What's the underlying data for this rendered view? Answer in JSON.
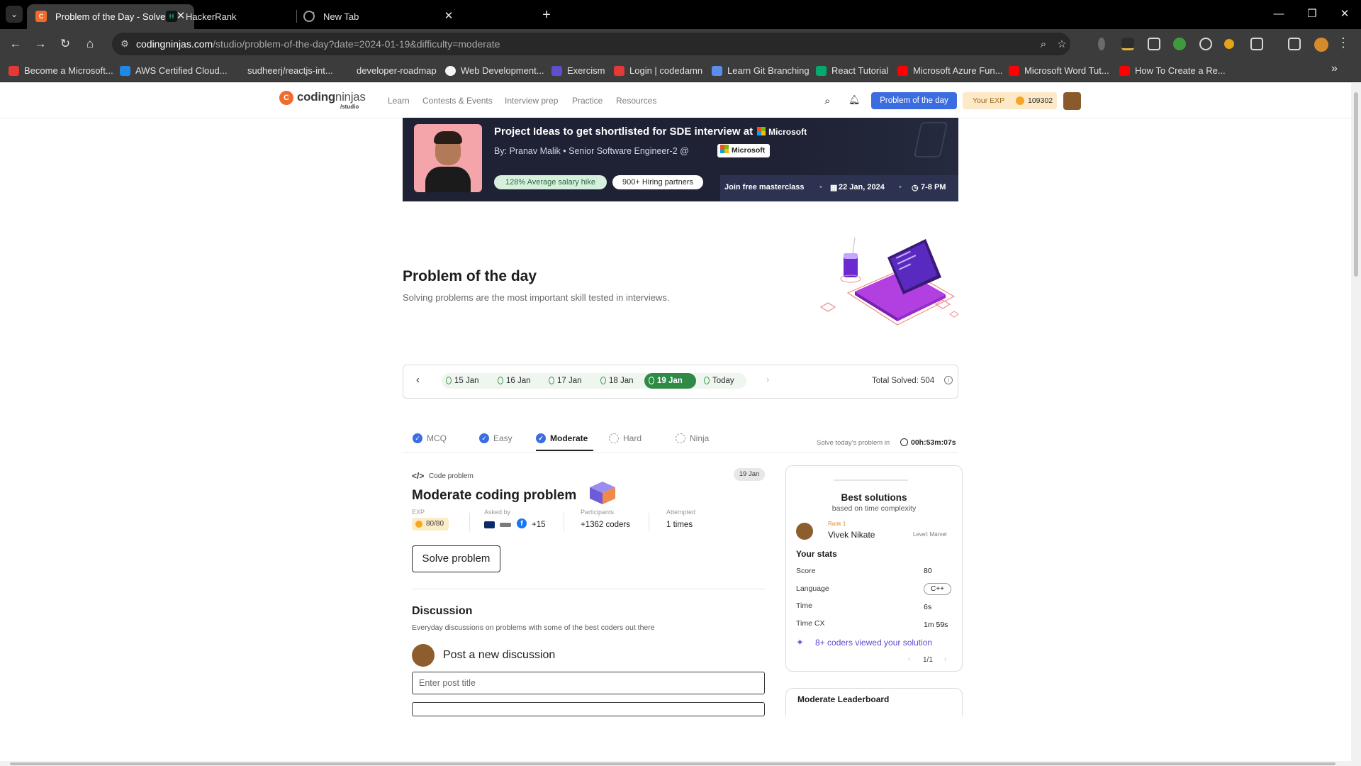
{
  "browser": {
    "tabs": [
      {
        "title": "Problem of the Day - Solve a N",
        "favicon_color": "#f16b2a",
        "favicon_glyph": "C",
        "active": true
      },
      {
        "title": "HackerRank",
        "favicon_color": "#1ba94c",
        "favicon_glyph": "H",
        "active": false
      },
      {
        "title": "New Tab",
        "favicon_color": "#9aa0a6",
        "favicon_glyph": "",
        "active": false
      }
    ],
    "url_host": "codingninjas.com",
    "url_path": "/studio/problem-of-the-day?date=2024-01-19&difficulty=moderate",
    "bookmarks": [
      {
        "label": "Become a Microsoft...",
        "color": "#e53935"
      },
      {
        "label": "AWS Certified Cloud...",
        "color": "#1e88e5"
      },
      {
        "label": "sudheerj/reactjs-int...",
        "color": "#3c3c3c"
      },
      {
        "label": "developer-roadmap",
        "color": "#3c3c3c"
      },
      {
        "label": "Web Development...",
        "color": "#f5f5f5"
      },
      {
        "label": "Exercism",
        "color": "#604fcd"
      },
      {
        "label": "Login | codedamn",
        "color": "#e53935"
      },
      {
        "label": "Learn Git Branching",
        "color": "#5b8def"
      },
      {
        "label": "React Tutorial",
        "color": "#04aa6d"
      },
      {
        "label": "Microsoft Azure Fun...",
        "color": "#ff0000"
      },
      {
        "label": "Microsoft Word Tut...",
        "color": "#ff0000"
      },
      {
        "label": "How To Create a Re...",
        "color": "#ff0000"
      }
    ]
  },
  "header": {
    "logo_bold": "coding",
    "logo_light": "ninjas",
    "logo_sub": "/studio",
    "nav": [
      "Learn",
      "Contests & Events",
      "Interview prep",
      "Practice",
      "Resources"
    ],
    "potd_button": "Problem of the day",
    "exp_label": "Your EXP",
    "exp_value": "109302"
  },
  "banner": {
    "title": "Project Ideas to get shortlisted for SDE interview at",
    "company": "Microsoft",
    "byline": "By: Pranav Malik  •  Senior Software Engineer-2 @",
    "chip": "Microsoft",
    "pill_salary": "128% Average salary hike",
    "pill_partners": "900+ Hiring partners",
    "cta": "Join free masterclass",
    "date": "22 Jan, 2024",
    "time": "7-8 PM"
  },
  "hero": {
    "title": "Problem of the day",
    "subtitle": "Solving problems are the most important skill tested in interviews."
  },
  "dates": {
    "items": [
      "15 Jan",
      "16 Jan",
      "17 Jan",
      "18 Jan",
      "19 Jan",
      "Today"
    ],
    "selected": "19 Jan",
    "total_solved": "Total Solved: 504"
  },
  "difficulty": {
    "tabs": [
      {
        "label": "MCQ",
        "done": true
      },
      {
        "label": "Easy",
        "done": true
      },
      {
        "label": "Moderate",
        "done": true
      },
      {
        "label": "Hard",
        "done": false
      },
      {
        "label": "Ninja",
        "done": false
      }
    ],
    "active": "Moderate",
    "timer_label": "Solve today's problem in",
    "timer_value": "00h:53m:07s"
  },
  "problem": {
    "type_label": "Code problem",
    "date_badge": "19 Jan",
    "title": "Moderate coding problem",
    "exp_label": "EXP",
    "exp_value": "80/80",
    "asked_by_label": "Asked by",
    "asked_by_more": "+15",
    "participants_label": "Participants",
    "participants_value": "+1362 coders",
    "attempted_label": "Attempted",
    "attempted_value": "1 times",
    "solve_button": "Solve problem"
  },
  "discussion": {
    "title": "Discussion",
    "subtitle": "Everyday discussions on problems with some of the best coders out there",
    "post_label": "Post a new discussion",
    "title_placeholder": "Enter post title"
  },
  "best": {
    "title": "Best solutions",
    "subtitle": "based on time complexity",
    "rank": "Rank 1",
    "name": "Vivek Nikate",
    "level": "Level: Marvel",
    "stats_title": "Your stats",
    "stats": [
      {
        "label": "Score",
        "value": "80"
      },
      {
        "label": "Language",
        "value": "C++"
      },
      {
        "label": "Time",
        "value": "6s"
      },
      {
        "label": "Time CX",
        "value": "1m 59s"
      }
    ],
    "viewed": "8+ coders viewed your solution",
    "pager": "1/1"
  },
  "leaderboard": {
    "title": "Moderate Leaderboard"
  }
}
